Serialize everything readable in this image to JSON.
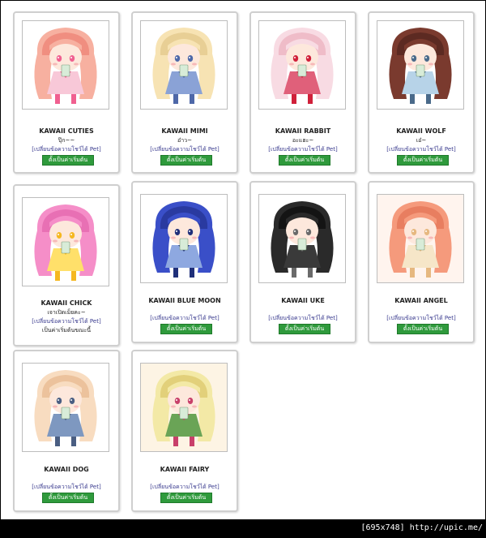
{
  "cards": [
    {
      "name": "KAWAII CUTIES",
      "subtitle": "ปุ๊ก~~",
      "link": "[เปลี่ยนข้อความโชว์ได้ Pet]",
      "button": "ตั้งเป็นค่าเริ่มต้น",
      "extra": "",
      "palette": {
        "hair": "#f7b0a0",
        "hair2": "#f08e80",
        "outfit": "#f8c8d8",
        "accent": "#f06090",
        "bg": "#ffffff"
      }
    },
    {
      "name": "KAWAII MIMI",
      "subtitle": "อ๋าว~",
      "link": "[เปลี่ยนข้อความโชว์ได้ Pet]",
      "button": "ตั้งเป็นค่าเริ่มต้น",
      "extra": "",
      "palette": {
        "hair": "#f7e3b3",
        "hair2": "#e8cf95",
        "outfit": "#8aa2d6",
        "accent": "#4e68a8",
        "bg": "#ffffff"
      }
    },
    {
      "name": "KAWAII RABBIT",
      "subtitle": "อะแฮะ~",
      "link": "[เปลี่ยนข้อความโชว์ได้ Pet]",
      "button": "ตั้งเป็นค่าเริ่มต้น",
      "extra": "",
      "palette": {
        "hair": "#f8dbe3",
        "hair2": "#efbcc8",
        "outfit": "#e0607a",
        "accent": "#d0203a",
        "bg": "#ffffff"
      }
    },
    {
      "name": "KAWAII WOLF",
      "subtitle": "เอ๋~",
      "link": "[เปลี่ยนข้อความโชว์ได้ Pet]",
      "button": "ตั้งเป็นค่าเริ่มต้น",
      "extra": "",
      "palette": {
        "hair": "#7a3a2e",
        "hair2": "#5c2a22",
        "outfit": "#b7d3e8",
        "accent": "#4a6a8a",
        "bg": "#ffffff"
      }
    },
    {
      "name": "KAWAII CHICK",
      "subtitle": "เจาเปิดเม็ยคะ~",
      "link": "[เปลี่ยนข้อความโชว์ได้ Pet]",
      "button": "",
      "extra": "เป็นค่าเริ่มต้นขณะนี้",
      "palette": {
        "hair": "#f58ec8",
        "hair2": "#e870b4",
        "outfit": "#ffe06a",
        "accent": "#f5b820",
        "bg": "#ffffff"
      }
    },
    {
      "name": "KAWAII BLUE MOON",
      "subtitle": "",
      "link": "[เปลี่ยนข้อความโชว์ได้ Pet]",
      "button": "ตั้งเป็นค่าเริ่มต้น",
      "extra": "",
      "palette": {
        "hair": "#3a4fc8",
        "hair2": "#2a3aa0",
        "outfit": "#8ea8e0",
        "accent": "#20307a",
        "bg": "#ffffff"
      }
    },
    {
      "name": "KAWAII UKE",
      "subtitle": "",
      "link": "[เปลี่ยนข้อความโชว์ได้ Pet]",
      "button": "ตั้งเป็นค่าเริ่มต้น",
      "extra": "",
      "palette": {
        "hair": "#2a2a2a",
        "hair2": "#141414",
        "outfit": "#3a3a3a",
        "accent": "#6a6a6a",
        "bg": "#ffffff"
      }
    },
    {
      "name": "KAWAII ANGEL",
      "subtitle": "",
      "link": "[เปลี่ยนข้อความโชว์ได้ Pet]",
      "button": "ตั้งเป็นค่าเริ่มต้น",
      "extra": "",
      "palette": {
        "hair": "#f59a7c",
        "hair2": "#e87e60",
        "outfit": "#f6e6c8",
        "accent": "#e6b880",
        "bg": "#fff4ee"
      }
    },
    {
      "name": "KAWAII DOG",
      "subtitle": "",
      "link": "[เปลี่ยนข้อความโชว์ได้ Pet]",
      "button": "ตั้งเป็นค่าเริ่มต้น",
      "extra": "",
      "palette": {
        "hair": "#f8dcc0",
        "hair2": "#ecc29c",
        "outfit": "#7e98c0",
        "accent": "#4a5e82",
        "bg": "#ffffff"
      }
    },
    {
      "name": "KAWAII FAIRY",
      "subtitle": "",
      "link": "[เปลี่ยนข้อความโชว์ได้ Pet]",
      "button": "ตั้งเป็นค่าเริ่มต้น",
      "extra": "",
      "palette": {
        "hair": "#f3e9a6",
        "hair2": "#e2d07a",
        "outfit": "#6aa456",
        "accent": "#c8406a",
        "bg": "#fdf4e4"
      }
    }
  ],
  "watermark": "[695x748] http://upic.me/"
}
